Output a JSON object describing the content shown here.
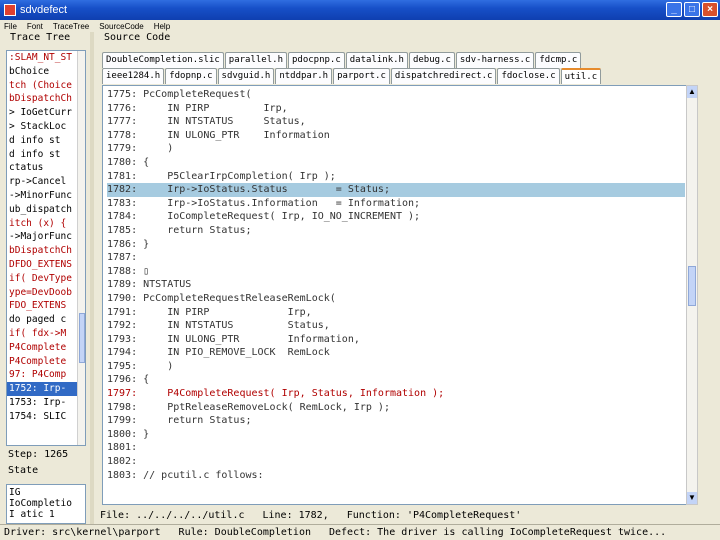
{
  "window": {
    "title": "sdvdefect"
  },
  "menu": [
    "File",
    "Font",
    "TraceTree",
    "SourceCode",
    "Help"
  ],
  "left": {
    "trace_title": "Trace Tree",
    "trace_lines": [
      {
        "text": ":SLAM_NT_ST",
        "red": true,
        "sel": false
      },
      {
        "text": "bChoice",
        "red": false,
        "sel": false
      },
      {
        "text": "tch (Choice",
        "red": true,
        "sel": false
      },
      {
        "text": "bDispatchCh",
        "red": true,
        "sel": false
      },
      {
        "text": "> IoGetCurr",
        "red": false,
        "sel": false
      },
      {
        "text": "> StackLoc",
        "red": false,
        "sel": false
      },
      {
        "text": "d info   st",
        "red": false,
        "sel": false
      },
      {
        "text": "d info   st",
        "red": false,
        "sel": false
      },
      {
        "text": "ctatus",
        "red": false,
        "sel": false
      },
      {
        "text": "rp->Cancel",
        "red": false,
        "sel": false
      },
      {
        "text": "->MinorFunc",
        "red": false,
        "sel": false
      },
      {
        "text": "ub_dispatch",
        "red": false,
        "sel": false
      },
      {
        "text": "itch (x) {",
        "red": true,
        "sel": false
      },
      {
        "text": "->MajorFunc",
        "red": false,
        "sel": false
      },
      {
        "text": "bDispatchCh",
        "red": true,
        "sel": false
      },
      {
        "text": "DFDO_EXTENS",
        "red": true,
        "sel": false
      },
      {
        "text": "if( DevType",
        "red": true,
        "sel": false
      },
      {
        "text": "ype=DevDoob",
        "red": true,
        "sel": false
      },
      {
        "text": "FDO_EXTENS",
        "red": true,
        "sel": false
      },
      {
        "text": "do paged c",
        "red": false,
        "sel": false
      },
      {
        "text": "if( fdx->M",
        "red": true,
        "sel": false
      },
      {
        "text": "P4Complete",
        "red": true,
        "sel": false
      },
      {
        "text": "P4Complete",
        "red": true,
        "sel": false
      },
      {
        "text": "97: P4Comp",
        "red": true,
        "sel": false
      },
      {
        "text": "1752: Irp-",
        "red": false,
        "sel": true
      },
      {
        "text": "1753: Irp-",
        "red": false,
        "sel": false
      },
      {
        "text": "1754: SLIC",
        "red": false,
        "sel": false
      }
    ],
    "step_text": "Step: 1265",
    "state_title": "State",
    "state_lines": [
      "IG",
      "IoCompletio",
      "I  atic 1"
    ]
  },
  "source": {
    "title": "Source Code",
    "tabs_row1": [
      "DoubleCompletion.slic",
      "parallel.h",
      "pdocpnp.c",
      "datalink.h",
      "debug.c",
      "sdv-harness.c",
      "fdcmp.c"
    ],
    "tabs_row2": [
      "ieee1284.h",
      "fdopnp.c",
      "sdvguid.h",
      "ntddpar.h",
      "parport.c",
      "dispatchredirect.c",
      "fdoclose.c",
      "util.c"
    ],
    "active_tab": "util.c",
    "lines": [
      {
        "text": "1775: PcCompleteRequest(",
        "hl": false,
        "red": false
      },
      {
        "text": "1776:     IN PIRP         Irp,",
        "hl": false,
        "red": false
      },
      {
        "text": "1777:     IN NTSTATUS     Status,",
        "hl": false,
        "red": false
      },
      {
        "text": "1778:     IN ULONG_PTR    Information",
        "hl": false,
        "red": false
      },
      {
        "text": "1779:     )",
        "hl": false,
        "red": false
      },
      {
        "text": "1780: {",
        "hl": false,
        "red": false
      },
      {
        "text": "1781:     P5ClearIrpCompletion( Irp );",
        "hl": false,
        "red": false
      },
      {
        "text": "1782:     Irp->IoStatus.Status        = Status;",
        "hl": true,
        "red": false
      },
      {
        "text": "1783:     Irp->IoStatus.Information   = Information;",
        "hl": false,
        "red": false
      },
      {
        "text": "1784:     IoCompleteRequest( Irp, IO_NO_INCREMENT );",
        "hl": false,
        "red": false
      },
      {
        "text": "1785:     return Status;",
        "hl": false,
        "red": false
      },
      {
        "text": "1786: }",
        "hl": false,
        "red": false
      },
      {
        "text": "1787:",
        "hl": false,
        "red": false
      },
      {
        "text": "1788: ▯",
        "hl": false,
        "red": false
      },
      {
        "text": "1789: NTSTATUS",
        "hl": false,
        "red": false
      },
      {
        "text": "1790: PcCompleteRequestReleaseRemLock(",
        "hl": false,
        "red": false
      },
      {
        "text": "1791:     IN PIRP             Irp,",
        "hl": false,
        "red": false
      },
      {
        "text": "1792:     IN NTSTATUS         Status,",
        "hl": false,
        "red": false
      },
      {
        "text": "1793:     IN ULONG_PTR        Information,",
        "hl": false,
        "red": false
      },
      {
        "text": "1794:     IN PIO_REMOVE_LOCK  RemLock",
        "hl": false,
        "red": false
      },
      {
        "text": "1795:     )",
        "hl": false,
        "red": false
      },
      {
        "text": "1796: {",
        "hl": false,
        "red": false
      },
      {
        "text": "1797:     P4CompleteRequest( Irp, Status, Information );",
        "hl": false,
        "red": true
      },
      {
        "text": "1798:     PptReleaseRemoveLock( RemLock, Irp );",
        "hl": false,
        "red": false
      },
      {
        "text": "1799:     return Status;",
        "hl": false,
        "red": false
      },
      {
        "text": "1800: }",
        "hl": false,
        "red": false
      },
      {
        "text": "1801:",
        "hl": false,
        "red": false
      },
      {
        "text": "1802:",
        "hl": false,
        "red": false
      },
      {
        "text": "1803: // pcutil.c follows:",
        "hl": false,
        "red": false
      }
    ],
    "info": {
      "file": "File: ../../../../util.c",
      "line": "Line: 1782,",
      "function": "Function: 'P4CompleteRequest'"
    }
  },
  "status": {
    "driver": "Driver: src\\kernel\\parport",
    "rule": "Rule: DoubleCompletion",
    "defect": "Defect: The driver is calling IoCompleteRequest twice..."
  }
}
